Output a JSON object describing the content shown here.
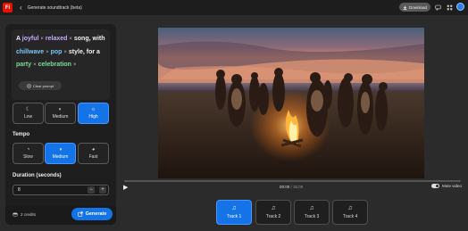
{
  "topbar": {
    "logo": "Fi",
    "back_icon": "‹",
    "title": "Generate soundtrack (beta)",
    "download_label": "Download"
  },
  "prompt": {
    "parts": [
      {
        "type": "word",
        "text": "A"
      },
      {
        "type": "tag",
        "text": "joyful",
        "color": "#c8a8ff"
      },
      {
        "type": "tag",
        "text": "relaxed",
        "color": "#c8a8ff"
      },
      {
        "type": "word",
        "text": "song, with"
      },
      {
        "type": "tag",
        "text": "chillwave",
        "color": "#7cc7f5"
      },
      {
        "type": "tag",
        "text": "pop",
        "color": "#7cc7f5"
      },
      {
        "type": "word",
        "text": "style, for a"
      },
      {
        "type": "tag",
        "text": "party",
        "color": "#7edc9c"
      },
      {
        "type": "tag",
        "text": "celebration",
        "color": "#7edc9c"
      }
    ],
    "clear_label": "Clear prompt"
  },
  "energy": {
    "options": [
      {
        "label": "Low",
        "icon": "☾",
        "selected": false
      },
      {
        "label": "Medium",
        "icon": "◐",
        "selected": false
      },
      {
        "label": "High",
        "icon": "☼",
        "selected": true
      }
    ]
  },
  "tempo": {
    "heading": "Tempo",
    "options": [
      {
        "label": "Slow",
        "icon": "◔",
        "selected": false
      },
      {
        "label": "Medium",
        "icon": "◑",
        "selected": true
      },
      {
        "label": "Fast",
        "icon": "◕",
        "selected": false
      }
    ]
  },
  "duration": {
    "heading": "Duration (seconds)",
    "value": "8",
    "minus": "−",
    "plus": "+"
  },
  "footer": {
    "credits": "2 credits",
    "generate_label": "Generate"
  },
  "player": {
    "current_time": "00:00",
    "total_time": "/ 15:00",
    "mute_label": "Mute video",
    "play_icon": "▶"
  },
  "tracks": [
    {
      "label": "Track 1",
      "selected": true
    },
    {
      "label": "Track 2",
      "selected": false
    },
    {
      "label": "Track 3",
      "selected": false
    },
    {
      "label": "Track 4",
      "selected": false
    }
  ],
  "colors": {
    "accent": "#1473e6",
    "background": "#2b2b2b",
    "panel": "#1e1e1e",
    "logo": "#eb1000"
  }
}
